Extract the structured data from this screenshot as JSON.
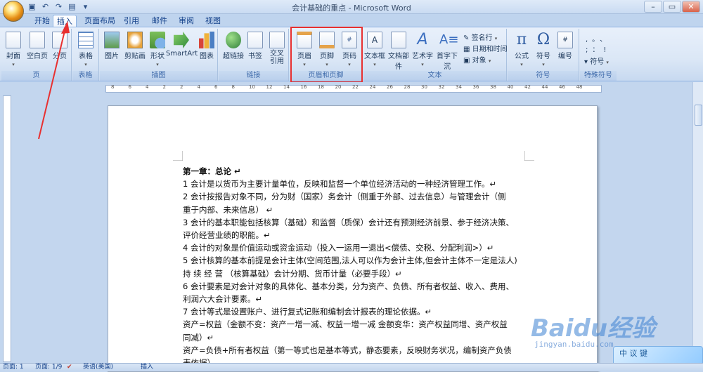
{
  "window": {
    "title": "会计基础的重点 - Microsoft Word"
  },
  "tabs": [
    "开始",
    "插入",
    "页面布局",
    "引用",
    "邮件",
    "审阅",
    "视图"
  ],
  "active_tab": "插入",
  "ribbon": {
    "groups": {
      "pages": {
        "label": "页",
        "buttons": [
          "封面",
          "空白页",
          "分页"
        ]
      },
      "tables": {
        "label": "表格",
        "buttons": [
          "表格"
        ]
      },
      "illustrations": {
        "label": "插图",
        "buttons": [
          "图片",
          "剪贴画",
          "形状",
          "SmartArt",
          "图表"
        ]
      },
      "links": {
        "label": "链接",
        "buttons": [
          "超链接",
          "书签",
          "交叉引用"
        ]
      },
      "header_footer": {
        "label": "页眉和页脚",
        "buttons": [
          "页眉",
          "页脚",
          "页码"
        ]
      },
      "text": {
        "label": "文本",
        "buttons": [
          "文本框",
          "文档部件",
          "艺术字",
          "首字下沉"
        ],
        "small": [
          "签名行",
          "日期和时间",
          "对象"
        ]
      },
      "symbols": {
        "label": "符号",
        "buttons": [
          "公式",
          "符号",
          "编号"
        ]
      },
      "special": {
        "label": "特殊符号",
        "small": [
          "符号"
        ]
      }
    }
  },
  "document": {
    "lines": [
      "第一章：总论 ↵",
      "1 会计是以货币为主要计量单位，反映和监督一个单位经济活动的一种经济管理工作。↵",
      "2 会计按报告对象不同，分为财（国家）务会计（侧重于外部、过去信息）与管理会计（侧",
      "重于内部、未来信息） ↵",
      "3 会计的基本职能包括核算（基础）和监督（质保）会计还有预测经济前景、参于经济决策、",
      "评价经营业绩的职能。↵",
      "4 会计的对象是价值运动或资金运动（投入一运用一退出<偿债、交税、分配利润>）↵",
      "5 会计核算的基本前提是会计主体(空间范围,法人可以作为会计主体,但会计主体不一定是法人)",
      "持 续 经 营 （核算基础）会计分期、货币计量（必要手段）↵",
      "6 会计要素是对会计对象的具体化、基本分类，分为资产、负债、所有者权益、收入、费用、",
      "利润六大会计要素。↵",
      "7 会计等式是设置账户、进行复式记账和编制会计报表的理论依据。↵",
      "资产=权益（金额不变：资产一增一减、权益一增一减 金额变华：资产权益同增、资产权益",
      "同减）↵",
      "资产=负债+所有者权益（第一等式也是基本等式，静态要素，反映财务状况，编制资产负债",
      "表依据）"
    ]
  },
  "ruler": {
    "numbers": [
      "8",
      "6",
      "4",
      "2",
      "2",
      "4",
      "6",
      "8",
      "10",
      "12",
      "14",
      "16",
      "18",
      "20",
      "22",
      "24",
      "26",
      "28",
      "30",
      "32",
      "34",
      "36",
      "38",
      "40",
      "42",
      "44",
      "46",
      "48"
    ]
  },
  "statusbar": {
    "page": "页面: 1",
    "pages": "页面: 1/9",
    "lang": "英语(美国)",
    "mode": "插入"
  },
  "watermark": {
    "brand": "Baidu经验",
    "url": "jingyan.baidu.com"
  },
  "ime": {
    "label": "中 议 键"
  }
}
